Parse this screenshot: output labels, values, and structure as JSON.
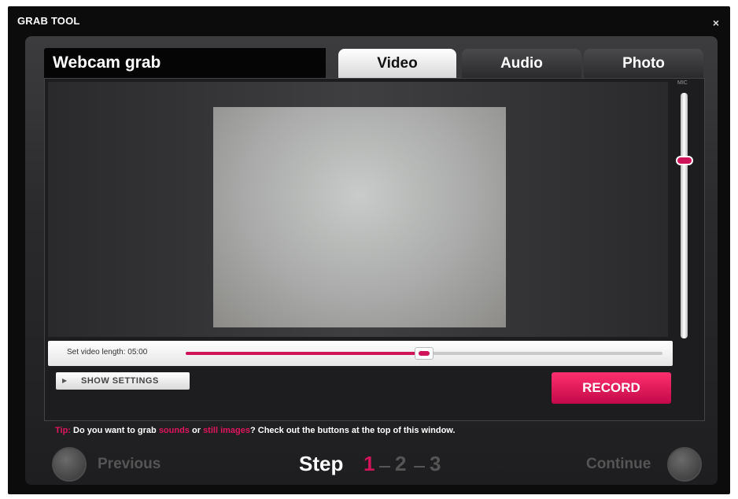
{
  "window": {
    "title": "GRAB TOOL",
    "close_symbol": "×"
  },
  "header": {
    "title": "Webcam grab"
  },
  "tabs": [
    {
      "label": "Video",
      "active": true
    },
    {
      "label": "Audio",
      "active": false
    },
    {
      "label": "Photo",
      "active": false
    }
  ],
  "vertical_slider": {
    "label": "MIC",
    "level": 0.29
  },
  "video_length": {
    "label": "Set video length: 05:00",
    "position": 0.5
  },
  "buttons": {
    "show_settings": "SHOW SETTINGS",
    "record": "RECORD"
  },
  "tip": {
    "prefix": "Tip:",
    "text1": " Do you want to grab ",
    "link1": "sounds",
    "text2": " or ",
    "link2": "still images",
    "text3": "? Check out the buttons at the top of this window."
  },
  "navigation": {
    "previous": "Previous",
    "continue": "Continue",
    "step_label": "Step",
    "steps": [
      "1",
      "2",
      "3"
    ],
    "current_step": 1
  },
  "colors": {
    "accent": "#d0145a",
    "inactive_step": "#555555"
  }
}
